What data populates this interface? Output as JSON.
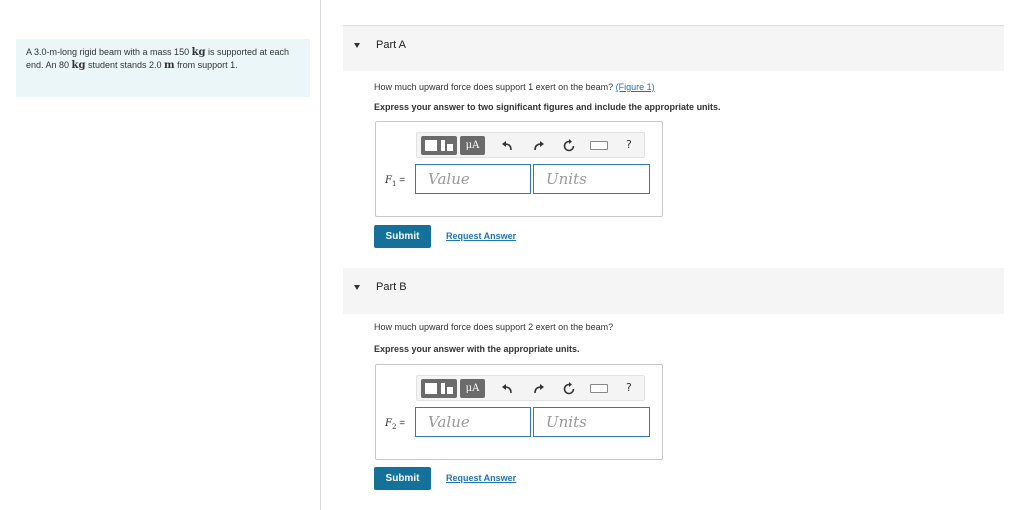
{
  "problem": {
    "t1": "A 3.0-m-long rigid beam with a mass 150 ",
    "u1": "kg",
    "t2": " is supported at each end. An 80 ",
    "u2": "kg",
    "t3": " student stands 2.0 ",
    "u3": "m",
    "t4": " from support 1."
  },
  "parts": [
    {
      "title": "Part A",
      "question": "How much upward force does support 1 exert on the beam? ",
      "figure_link": "(Figure 1)",
      "instruction": "Express your answer to two significant figures and include the appropriate units.",
      "var_letter": "F",
      "var_sub": "1",
      "eq": " =",
      "value_placeholder": "Value",
      "units_placeholder": "Units",
      "mu_label": "μA",
      "help": "?",
      "submit": "Submit",
      "request": "Request Answer"
    },
    {
      "title": "Part B",
      "question": "How much upward force does support 2 exert on the beam?",
      "instruction": "Express your answer with the appropriate units.",
      "var_letter": "F",
      "var_sub": "2",
      "eq": " =",
      "value_placeholder": "Value",
      "units_placeholder": "Units",
      "mu_label": "μA",
      "help": "?",
      "submit": "Submit",
      "request": "Request Answer"
    }
  ],
  "icons": [
    "templates-icon",
    "undo-icon",
    "redo-icon",
    "reset-icon",
    "keyboard-icon",
    "help-icon"
  ],
  "colors": {
    "accent": "#13719a",
    "link": "#1f74b5",
    "problem_bg": "#eaf6f7",
    "header_bg": "#f5f5f5"
  }
}
